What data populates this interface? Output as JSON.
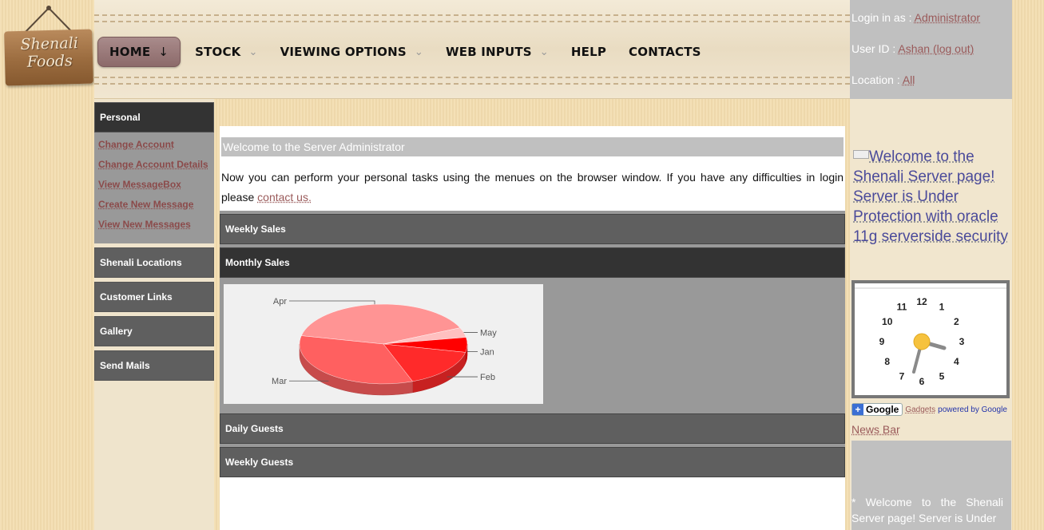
{
  "logo": {
    "line1": "Shenali",
    "line2": "Foods"
  },
  "nav": {
    "items": [
      {
        "label": "HOME",
        "arrow": "↓",
        "active": true
      },
      {
        "label": "STOCK",
        "arrow": "⌄"
      },
      {
        "label": "VIEWING OPTIONS",
        "arrow": "⌄"
      },
      {
        "label": "WEB INPUTS",
        "arrow": "⌄"
      },
      {
        "label": "HELP",
        "arrow": ""
      },
      {
        "label": "CONTACTS",
        "arrow": ""
      }
    ]
  },
  "login": {
    "login_label": "Login in as : ",
    "login_value": "Administrator",
    "userid_label": "User ID : ",
    "userid_value": "Ashan (log out)",
    "location_label": "Location : ",
    "location_value": "All"
  },
  "sidebar": {
    "personal_title": "Personal",
    "personal_links": [
      "Change Account",
      "Change Account Details",
      "View MessageBox",
      "Create New Message",
      "View New Messages"
    ],
    "sections": [
      "Shenali Locations",
      "Customer Links",
      "Gallery",
      "Send Mails"
    ]
  },
  "main": {
    "welcome": "Welcome to the Server Administrator",
    "intro_text": "Now you can perform your personal tasks using the menues on the browser window. If you have any difficulties in login please ",
    "contact_link": "contact us.",
    "accordion": [
      "Weekly Sales",
      "Monthly Sales",
      "Daily Guests",
      "Weekly Guests"
    ]
  },
  "chart_data": {
    "type": "pie",
    "categories": [
      "Apr",
      "May",
      "Jan",
      "Feb",
      "Mar"
    ],
    "values": [
      40,
      4,
      6,
      16,
      34
    ],
    "colors": [
      "#ff9494",
      "#ffc0c0",
      "#ff0000",
      "#ff2a2a",
      "#ff6060"
    ]
  },
  "right": {
    "marquee": "Welcome to the Shenali Server page! Server is Under Protection with oracle 11g serverside security",
    "clock_numbers": [
      "12",
      "1",
      "2",
      "3",
      "4",
      "5",
      "6",
      "7",
      "8",
      "9",
      "10",
      "11"
    ],
    "gadget_google": "Google",
    "gadget_gadgets": "Gadgets",
    "gadget_powered": "powered by Google",
    "news_label": "News Bar",
    "news_text": "* Welcome to the Shenali Server page! Server is Under"
  }
}
